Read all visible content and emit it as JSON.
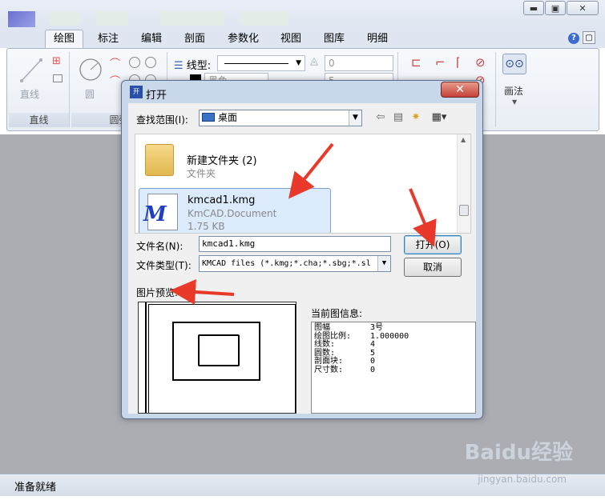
{
  "window": {
    "menu_tabs": [
      "绘图",
      "标注",
      "编辑",
      "剖面",
      "参数化",
      "视图",
      "图库",
      "明细"
    ],
    "active_tab": "绘图",
    "help": "?"
  },
  "ribbon": {
    "line_tool": "直线",
    "line_group": "直线",
    "circle_tool": "圆",
    "circle_group": "圆弧",
    "linetype_label": "线型:",
    "value_field_1": "0",
    "value_field_2": "5",
    "color_label": "黑色",
    "drawing_method": "画法"
  },
  "status_text": "准备就绪",
  "watermark": {
    "brand": "Baidu经验",
    "url": "jingyan.baidu.com"
  },
  "dialog": {
    "title": "打开",
    "look_in_label": "查找范围(I):",
    "look_in_value": "桌面",
    "files": [
      {
        "name": "新建文件夹 (2)",
        "type": "文件夹",
        "size": ""
      },
      {
        "name": "kmcad1.kmg",
        "type": "KmCAD.Document",
        "size": "1.75 KB",
        "selected": true
      }
    ],
    "filename_label": "文件名(N):",
    "filename_value": "kmcad1.kmg",
    "filetype_label": "文件类型(T):",
    "filetype_value": "KMCAD  files (*.kmg;*.cha;*.sbg;*.sl",
    "open_button": "打开(O)",
    "cancel_button": "取消",
    "preview_label": "图片预览:",
    "info_label": "当前图信息:",
    "info": [
      {
        "key": "图幅",
        "value": "  3号"
      },
      {
        "key": "绘图比例:",
        "value": "1.000000"
      },
      {
        "key": "线数:",
        "value": "4"
      },
      {
        "key": "圆数:",
        "value": "5"
      },
      {
        "key": "剖面块:",
        "value": "0"
      },
      {
        "key": "尺寸数:",
        "value": "0"
      }
    ]
  }
}
